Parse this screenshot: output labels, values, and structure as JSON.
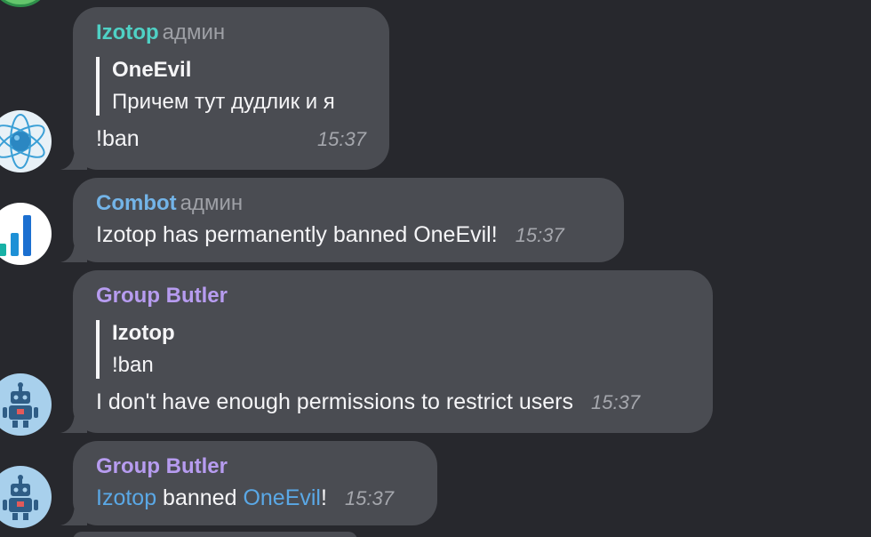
{
  "messages": [
    {
      "sender": "Izotop",
      "role": "админ",
      "quote": {
        "author": "OneEvil",
        "text": "Причем тут дудлик и я"
      },
      "text": "!ban",
      "time": "15:37"
    },
    {
      "sender": "Combot",
      "role": "админ",
      "text": "Izotop has permanently banned OneEvil!",
      "time": "15:37"
    },
    {
      "sender": "Group Butler",
      "quote": {
        "author": "Izotop",
        "text": "!ban"
      },
      "text": "I don't have enough permissions to restrict users",
      "time": "15:37"
    },
    {
      "sender": "Group Butler",
      "parts": {
        "user1": "Izotop",
        "middle": " banned ",
        "user2": "OneEvil",
        "end": "!"
      },
      "time": "15:37"
    }
  ],
  "icons": {
    "atom_avatar": "atom-icon",
    "combot_avatar": "bar-chart-icon",
    "butler_avatar": "robot-icon"
  },
  "colors": {
    "background": "#27282d",
    "bubble": "#4a4c52",
    "izotop_name": "#4fd1c5",
    "combot_name": "#73b4e8",
    "butler_name": "#b79cf0",
    "link": "#5aa8e6"
  }
}
